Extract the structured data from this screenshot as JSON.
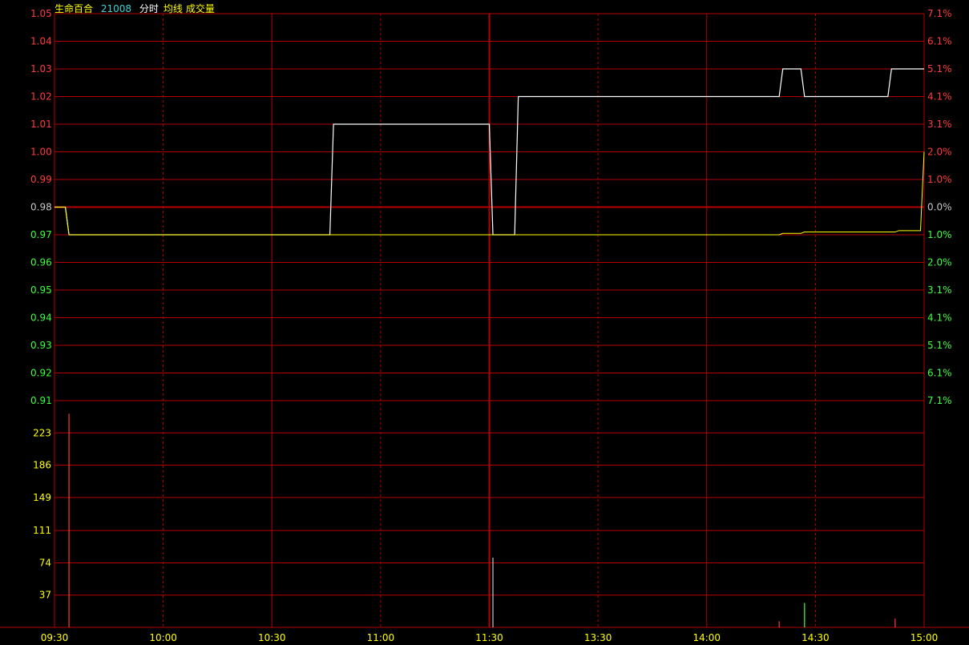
{
  "header": {
    "name": "生命百合",
    "code": "21008",
    "label_min": "分时",
    "label_avg": "均线",
    "label_vol": "成交量"
  },
  "colors": {
    "background": "#000000",
    "grid": "#b40000",
    "up": "#ff3b3b",
    "down": "#3dff3d",
    "flat": "#c8c8c8",
    "price_line": "#ffffff",
    "avg_line": "#ffff00",
    "vol_label": "#ffff00",
    "time_label": "#ffff00"
  },
  "chart_data": {
    "type": "line",
    "prev_close": 0.98,
    "price_axis": {
      "ylim": [
        0.91,
        1.05
      ],
      "ticks": [
        "1.05",
        "1.04",
        "1.03",
        "1.02",
        "1.01",
        "1.00",
        "0.99",
        "0.98",
        "0.97",
        "0.96",
        "0.95",
        "0.94",
        "0.93",
        "0.92",
        "0.91"
      ]
    },
    "pct_axis": {
      "ticks": [
        "7.1%",
        "6.1%",
        "5.1%",
        "4.1%",
        "3.1%",
        "2.0%",
        "1.0%",
        "0.0%",
        "1.0%",
        "2.0%",
        "3.1%",
        "4.1%",
        "5.1%",
        "6.1%",
        "7.1%"
      ]
    },
    "volume_axis": {
      "ylim": [
        0,
        260
      ],
      "ticks": [
        "223",
        "186",
        "149",
        "111",
        "74",
        "37"
      ]
    },
    "time_ticks": [
      "09:30",
      "10:00",
      "10:30",
      "11:00",
      "11:30",
      "13:30",
      "14:00",
      "14:30",
      "15:00"
    ],
    "price_series": {
      "name": "分时",
      "points": [
        [
          0,
          0.98
        ],
        [
          3,
          0.98
        ],
        [
          4,
          0.97
        ],
        [
          76,
          0.97
        ],
        [
          77,
          1.01
        ],
        [
          120,
          1.01
        ],
        [
          121,
          0.97
        ],
        [
          127,
          0.97
        ],
        [
          128,
          1.02
        ],
        [
          200,
          1.02
        ],
        [
          201,
          1.03
        ],
        [
          206,
          1.03
        ],
        [
          207,
          1.02
        ],
        [
          230,
          1.02
        ],
        [
          231,
          1.03
        ],
        [
          240,
          1.03
        ]
      ]
    },
    "avg_series": {
      "name": "均线",
      "points": [
        [
          0,
          0.98
        ],
        [
          3,
          0.98
        ],
        [
          4,
          0.97
        ],
        [
          200,
          0.97
        ],
        [
          201,
          0.9705
        ],
        [
          206,
          0.9705
        ],
        [
          207,
          0.971
        ],
        [
          232,
          0.971
        ],
        [
          233,
          0.9715
        ],
        [
          239,
          0.9715
        ],
        [
          240,
          1.0
        ]
      ]
    },
    "volume_series": {
      "name": "成交量",
      "bars": [
        [
          4,
          245,
          "up"
        ],
        [
          121,
          80,
          "flat"
        ],
        [
          200,
          7,
          "up"
        ],
        [
          207,
          28,
          "down"
        ],
        [
          232,
          10,
          "up"
        ]
      ]
    }
  }
}
